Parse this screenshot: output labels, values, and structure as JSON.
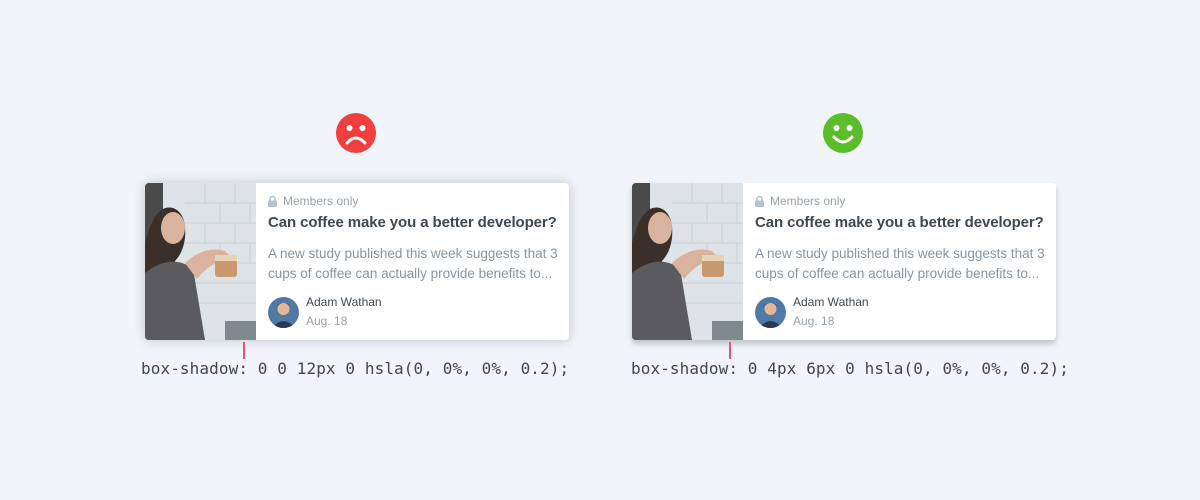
{
  "examples": [
    {
      "verdict_icon": "sad-face-icon",
      "verdict_color": "#ef3f3f",
      "card": {
        "members_label": "Members only",
        "title": "Can coffee make you a better developer?",
        "excerpt": "A new study published this week suggests that 3 cups of coffee can actually provide benefits to...",
        "author_name": "Adam Wathan",
        "date": "Aug. 18"
      },
      "code": "box-shadow: 0 0 12px 0 hsla(0, 0%, 0%, 0.2);"
    },
    {
      "verdict_icon": "happy-face-icon",
      "verdict_color": "#5cbd2a",
      "card": {
        "members_label": "Members only",
        "title": "Can coffee make you a better developer?",
        "excerpt": "A new study published this week suggests that 3 cups of coffee can actually provide benefits to...",
        "author_name": "Adam Wathan",
        "date": "Aug. 18"
      },
      "code": "box-shadow: 0 4px 6px 0 hsla(0, 0%, 0%, 0.2);"
    }
  ],
  "colors": {
    "background": "#f1f4f8",
    "marker": "#e35575"
  }
}
